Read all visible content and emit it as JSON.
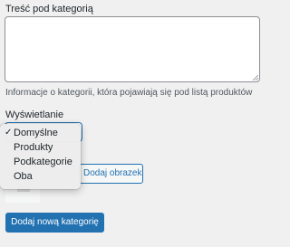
{
  "form": {
    "content_label": "Treść pod kategorią",
    "content_value": "",
    "help_text": "Informacje o kategorii, która pojawiają się pod listą produktów",
    "display_label": "Wyświetlanie",
    "display_selected": "Domyślne",
    "add_image_label": "Dodaj obrazek",
    "submit_label": "Dodaj nową kategorię"
  },
  "dropdown": {
    "check_symbol": "✓",
    "options": [
      "Domyślne",
      "Produkty",
      "Podkategorie",
      "Oba"
    ],
    "selected_index": 0
  },
  "colors": {
    "accent": "#2271b1",
    "page_background": "#f0f0f1"
  }
}
